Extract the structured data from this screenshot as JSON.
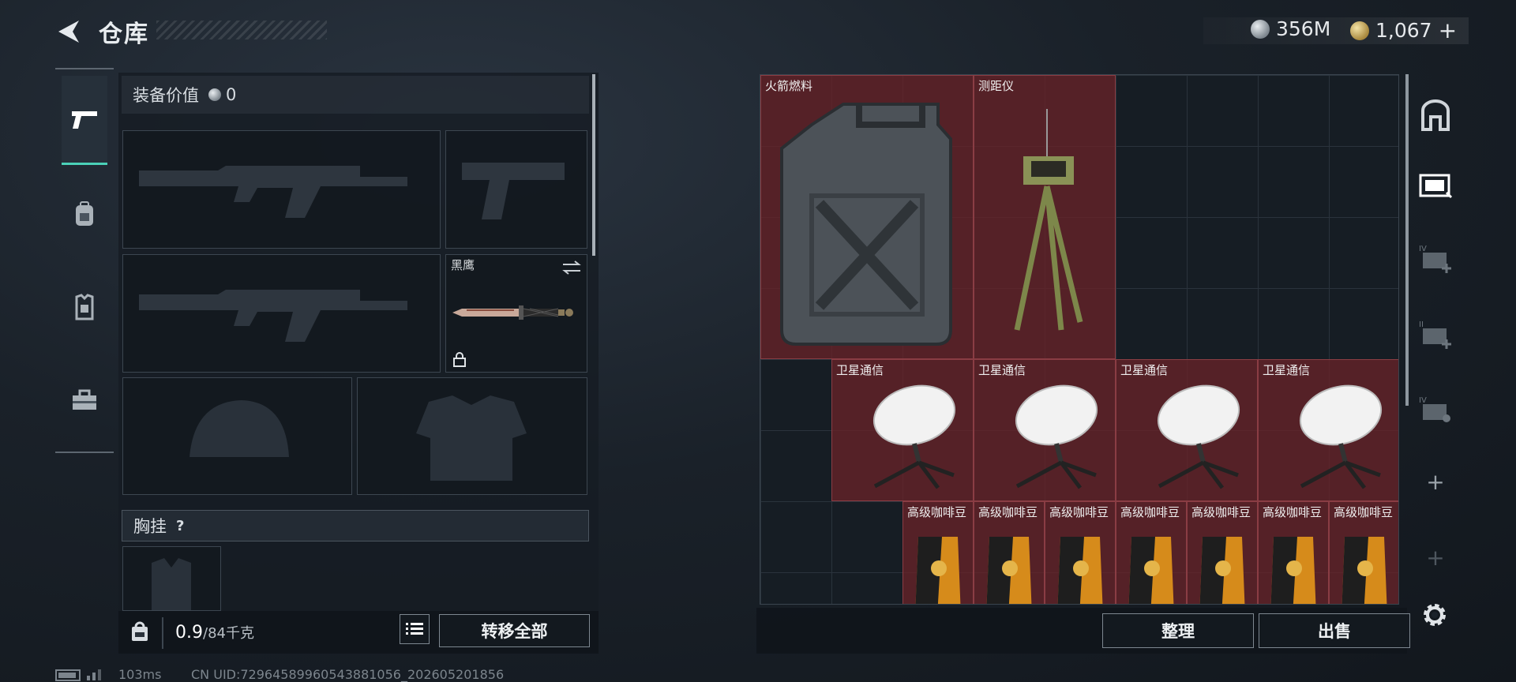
{
  "header": {
    "title": "仓库",
    "currency_silver": "356M",
    "currency_gold": "1,067",
    "add_symbol": "+"
  },
  "tabs": [
    {
      "icon": "pistol-icon",
      "active": true
    },
    {
      "icon": "backpack-icon",
      "active": false
    },
    {
      "icon": "vest-icon",
      "active": false
    },
    {
      "icon": "toolbox-icon",
      "active": false
    }
  ],
  "equipment": {
    "value_label": "装备价值",
    "value": "0",
    "melee_name": "黑鹰",
    "rig_label": "胸挂",
    "rig_help": "?",
    "weight_current": "0.9",
    "weight_max": "/84千克",
    "transfer_all": "转移全部"
  },
  "storage": {
    "items": [
      {
        "name": "火箭燃料",
        "type": "jerrycan"
      },
      {
        "name": "测距仪",
        "type": "rangefinder"
      },
      {
        "name": "卫星通信",
        "type": "dish"
      },
      {
        "name": "卫星通信",
        "type": "dish"
      },
      {
        "name": "卫星通信",
        "type": "dish"
      },
      {
        "name": "卫星通信",
        "type": "dish"
      },
      {
        "name": "高级咖啡豆",
        "type": "coffee"
      },
      {
        "name": "高级咖啡豆",
        "type": "coffee"
      },
      {
        "name": "高级咖啡豆",
        "type": "coffee"
      },
      {
        "name": "高级咖啡豆",
        "type": "coffee"
      },
      {
        "name": "高级咖啡豆",
        "type": "coffee"
      },
      {
        "name": "高级咖啡豆",
        "type": "coffee"
      },
      {
        "name": "高级咖啡豆",
        "type": "coffee"
      }
    ],
    "sort_label": "整理",
    "sell_label": "出售"
  },
  "status": {
    "ping": "103ms",
    "uid": "CN UID:729645899605438810​56_202605201856"
  },
  "colors": {
    "accent": "#4bd1b8",
    "item_bg": "#682228"
  }
}
